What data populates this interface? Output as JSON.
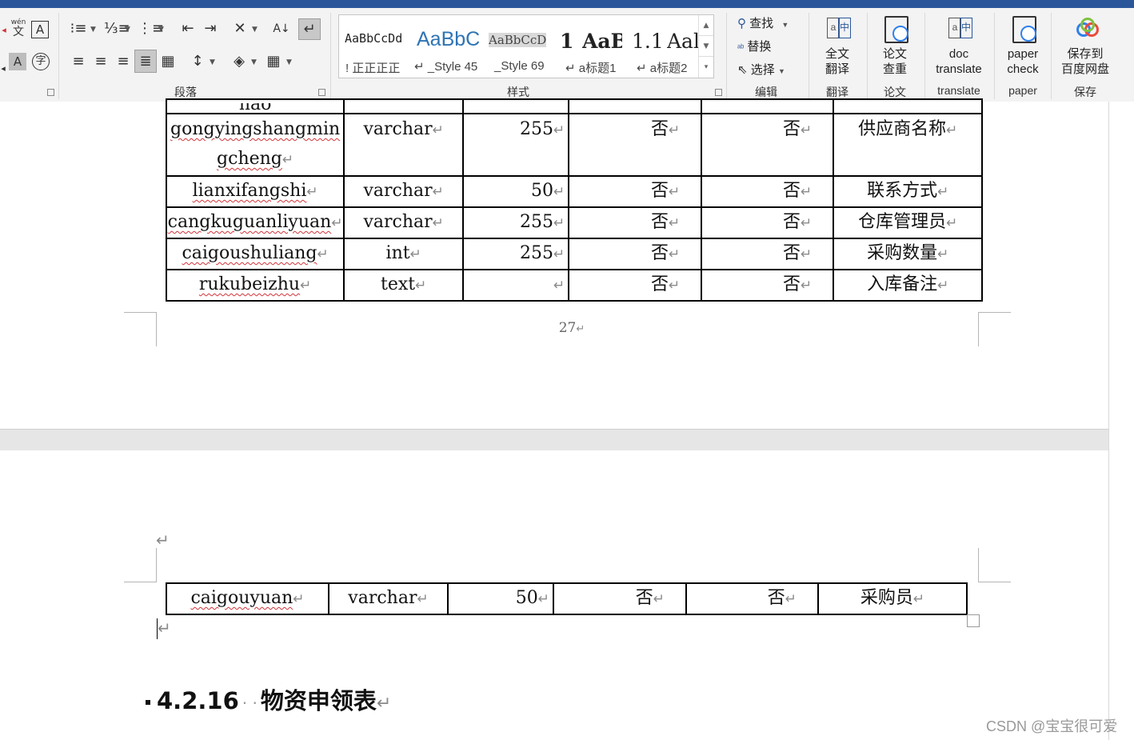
{
  "ribbon": {
    "groups": {
      "paragraph": "段落",
      "styles": "样式",
      "editing": "编辑",
      "translate1": "翻译",
      "paper1": "论文",
      "translate2": "translate",
      "paper2": "paper",
      "save": "保存"
    },
    "pinyin_glyph": "wén",
    "pinyin_glyph2": "文",
    "styles_gallery": [
      {
        "preview": "AaBbCcDd",
        "name": "! 正正正正"
      },
      {
        "preview": "AaBbC",
        "name": "↵ _Style 45"
      },
      {
        "preview": "AaBbCcD",
        "name": "_Style 69"
      },
      {
        "preview": "1",
        "name": ""
      },
      {
        "preview": "AaB",
        "name": "↵ a标题1"
      },
      {
        "preview": "1.1",
        "name": ""
      },
      {
        "preview": "Aal",
        "name": "↵ a标题2"
      }
    ],
    "editing": {
      "find": "查找",
      "replace": "替换",
      "select": "选择"
    },
    "buttons": {
      "full_translate_1": "全文",
      "full_translate_2": "翻译",
      "paper_check_cn_1": "论文",
      "paper_check_cn_2": "查重",
      "doc_translate_1": "doc",
      "doc_translate_2": "translate",
      "paper_check_1": "paper",
      "paper_check_2": "check",
      "save_baidu_1": "保存到",
      "save_baidu_2": "百度网盘"
    },
    "colors": {
      "accent": "#2b579a",
      "baidu_blue": "#2f80ed"
    }
  },
  "document": {
    "partial_row_text": "hao",
    "table_rows": [
      {
        "name": "gongyingshangmin",
        "name2": "gcheng",
        "type": "varchar",
        "length": "255",
        "nullable": "否",
        "pk": "否",
        "desc": "供应商名称"
      },
      {
        "name": "lianxifangshi",
        "type": "varchar",
        "length": "50",
        "nullable": "否",
        "pk": "否",
        "desc": "联系方式"
      },
      {
        "name": "cangkuguanliyuan",
        "type": "varchar",
        "length": "255",
        "nullable": "否",
        "pk": "否",
        "desc": "仓库管理员"
      },
      {
        "name": "caigoushuliang",
        "type": "int",
        "length": "255",
        "nullable": "否",
        "pk": "否",
        "desc": "采购数量"
      },
      {
        "name": "rukubeizhu",
        "type": "text",
        "length": "",
        "nullable": "否",
        "pk": "否",
        "desc": "入库备注"
      }
    ],
    "page_number": "27",
    "page2_row": {
      "name": "caigouyuan",
      "type": "varchar",
      "length": "50",
      "nullable": "否",
      "pk": "否",
      "desc": "采购员"
    },
    "heading": "4.2.16",
    "heading_text": "物资申领表",
    "para_mark": "↵"
  },
  "watermark": "CSDN @宝宝很可爱"
}
